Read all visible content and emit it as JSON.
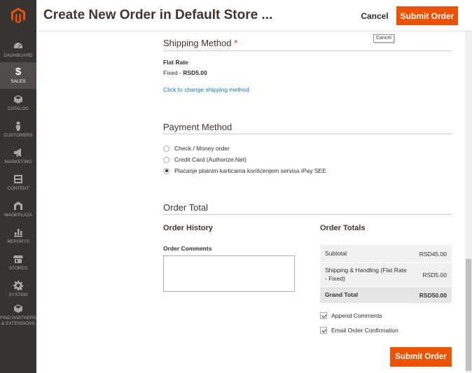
{
  "header": {
    "title": "Create New Order in Default Store ...",
    "cancel_label": "Cancel",
    "submit_label": "Submit Order",
    "tooltip": "Cancel"
  },
  "sidebar": {
    "items": [
      {
        "label": "DASHBOARD",
        "icon": "dashboard-icon"
      },
      {
        "label": "SALES",
        "icon": "dollar-icon",
        "active": true
      },
      {
        "label": "CATALOG",
        "icon": "catalog-icon"
      },
      {
        "label": "CUSTOMERS",
        "icon": "customers-icon"
      },
      {
        "label": "MARKETING",
        "icon": "megaphone-icon"
      },
      {
        "label": "CONTENT",
        "icon": "content-icon"
      },
      {
        "label": "MAGEPLAZA",
        "icon": "mageplaza-icon"
      },
      {
        "label": "REPORTS",
        "icon": "reports-icon"
      },
      {
        "label": "STORES",
        "icon": "stores-icon"
      },
      {
        "label": "SYSTEM",
        "icon": "gear-icon"
      },
      {
        "label": "FIND PARTNERS & EXTENSIONS",
        "icon": "extensions-icon"
      }
    ]
  },
  "shipping": {
    "title": "Shipping Method",
    "required_mark": "*",
    "method_name": "Flat Rate",
    "method_label": "Fixed - ",
    "method_price": "RSD5.00",
    "change_link": "Click to change shipping method"
  },
  "payment": {
    "title": "Payment Method",
    "options": [
      {
        "label": "Check / Money order",
        "selected": false
      },
      {
        "label": "Credit Card (Authorize.Net)",
        "selected": false
      },
      {
        "label": "Plaćanje platnim karticama korišćenjem servisa iPay SEE",
        "selected": true
      }
    ]
  },
  "order_total": {
    "title": "Order Total",
    "history_title": "Order History",
    "comments_label": "Order Comments",
    "comments_value": "",
    "totals_title": "Order Totals",
    "rows": [
      {
        "label": "Subtotal",
        "value": "RSD45.00"
      },
      {
        "label": "Shipping & Handling (Flat Rate - Fixed)",
        "value": "RSD5.00"
      },
      {
        "label": "Grand Total",
        "value": "RSD50.00"
      }
    ],
    "append_comments": "Append Comments",
    "email_confirmation": "Email Order Confirmation",
    "submit_label": "Submit Order"
  },
  "colors": {
    "accent": "#eb5202",
    "sidebar": "#373330",
    "link": "#1979c3"
  }
}
